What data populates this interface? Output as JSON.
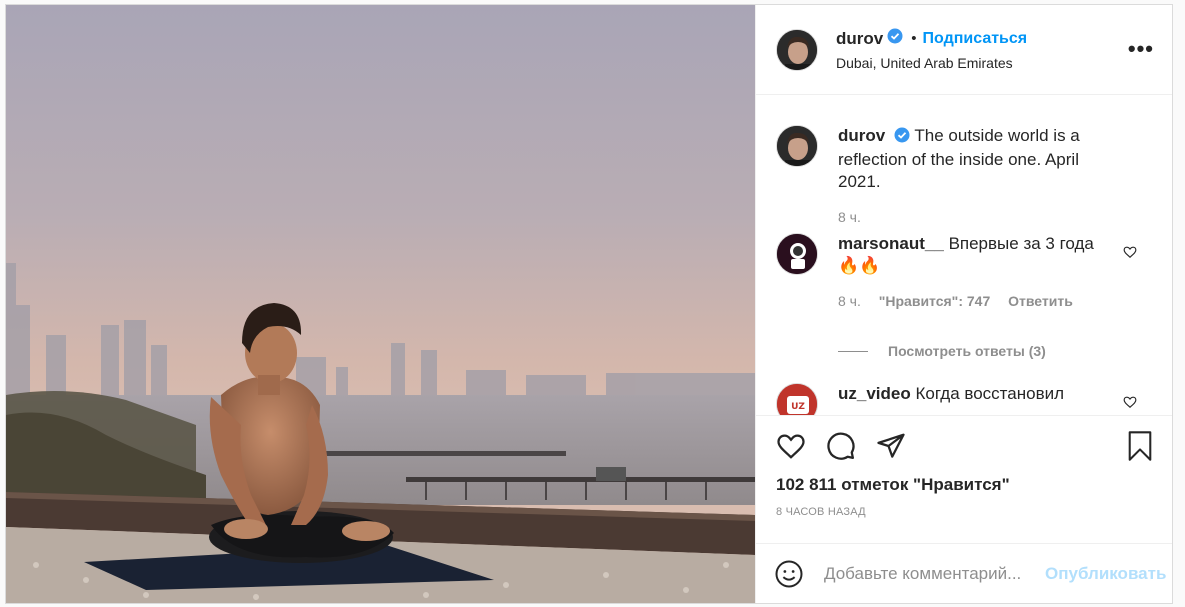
{
  "post": {
    "author": "durov",
    "follow_label": "Подписаться",
    "dot": "•",
    "location": "Dubai, United Arab Emirates",
    "more_label": "•••",
    "caption": "The outside world is a reflection of the inside one. April 2021.",
    "caption_time": "8 ч."
  },
  "comments": [
    {
      "user": "marsonaut__",
      "text": "Впервые за 3 года 🔥🔥",
      "time": "8 ч.",
      "likes": "\"Нравится\": 747",
      "reply": "Ответить",
      "view_replies": "Посмотреть ответы (3)"
    },
    {
      "user": "uz_video",
      "text": "Когда восстановил"
    }
  ],
  "actions": {
    "likes_count": "102 811 отметок \"Нравится\"",
    "posted_ago": "8 ЧАСОВ НАЗАД"
  },
  "composer": {
    "placeholder": "Добавьте комментарий...",
    "publish_label": "Опубликовать"
  },
  "colors": {
    "accent": "#0095f6",
    "verified": "#3897f0",
    "publish_disabled": "#b2dffc"
  },
  "icons": {
    "like": "heart-icon",
    "comment": "comment-icon",
    "share": "paper-plane-icon",
    "save": "bookmark-icon",
    "emoji": "smiley-icon",
    "verified": "verified-badge-icon"
  }
}
